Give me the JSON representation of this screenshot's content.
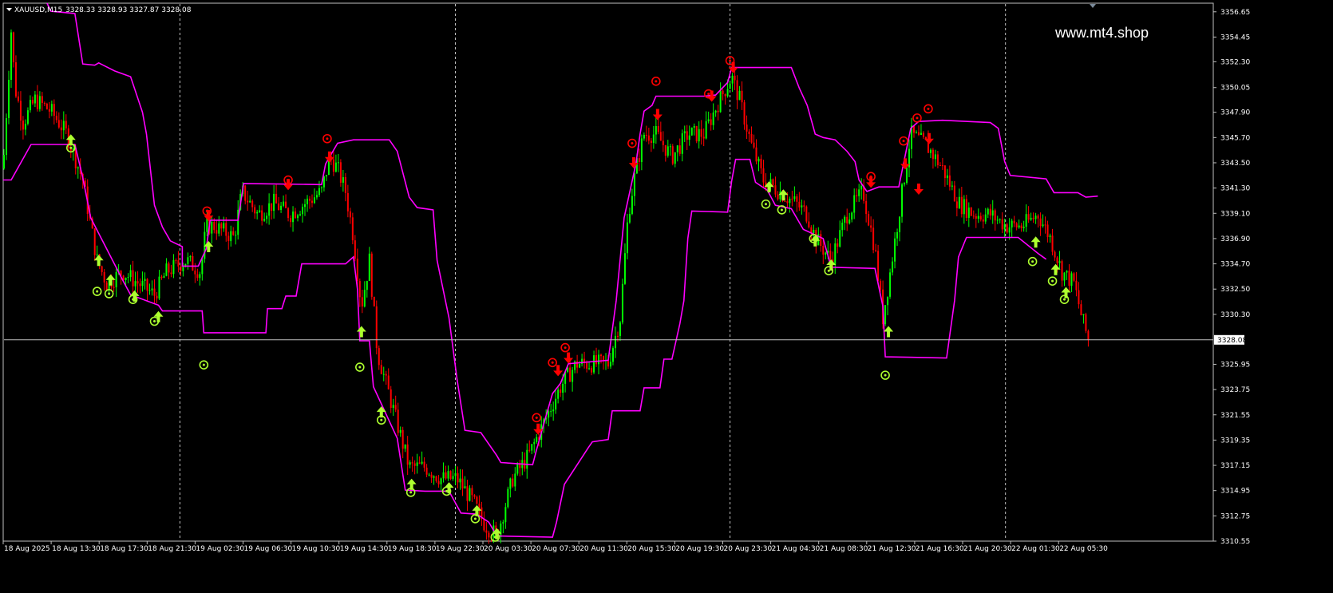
{
  "header": {
    "symbol": "XAUUSD,M15",
    "ohlc": "3328.33 3328.93 3327.87 3328.08"
  },
  "watermark": "www.mt4.shop",
  "colors": {
    "background": "#000000",
    "frame": "#c0c0c0",
    "bull_candle": "#00ff00",
    "bear_candle": "#ff0000",
    "envelope": "#ff00ff",
    "up_signal": "#adff2f",
    "down_signal": "#ff0000",
    "price_line": "#c0c0c0"
  },
  "chart_data": {
    "type": "line",
    "title": "XAUUSD,M15",
    "ylim": [
      3310.55,
      3357.4
    ],
    "y_ticks": [
      "3356.65",
      "3354.45",
      "3352.30",
      "3350.05",
      "3347.90",
      "3345.70",
      "3343.50",
      "3341.30",
      "3339.10",
      "3336.90",
      "3334.70",
      "3332.50",
      "3330.30",
      "3325.95",
      "3323.75",
      "3321.55",
      "3319.35",
      "3317.15",
      "3314.95",
      "3312.75",
      "3310.55"
    ],
    "current_price": "3328.08",
    "x_labels": [
      "18 Aug 2025",
      "18 Aug 13:30",
      "18 Aug 17:30",
      "18 Aug 21:30",
      "19 Aug 02:30",
      "19 Aug 06:30",
      "19 Aug 10:30",
      "19 Aug 14:30",
      "19 Aug 18:30",
      "19 Aug 22:30",
      "20 Aug 03:30",
      "20 Aug 07:30",
      "20 Aug 11:30",
      "20 Aug 15:30",
      "20 Aug 19:30",
      "20 Aug 23:30",
      "21 Aug 04:30",
      "21 Aug 08:30",
      "21 Aug 12:30",
      "21 Aug 16:30",
      "21 Aug 20:30",
      "22 Aug 01:30",
      "22 Aug 05:30"
    ],
    "x_domain": [
      0,
      1520
    ],
    "day_separators": [
      222,
      568,
      913,
      1259
    ],
    "price_path": [
      [
        0,
        3343
      ],
      [
        10,
        3355
      ],
      [
        15,
        3350
      ],
      [
        25,
        3347
      ],
      [
        40,
        3349
      ],
      [
        60,
        3348
      ],
      [
        80,
        3346
      ],
      [
        100,
        3342
      ],
      [
        110,
        3338
      ],
      [
        118,
        3335
      ],
      [
        130,
        3333
      ],
      [
        150,
        3334
      ],
      [
        170,
        3333
      ],
      [
        190,
        3332
      ],
      [
        205,
        3334
      ],
      [
        230,
        3335
      ],
      [
        248,
        3334
      ],
      [
        255,
        3338
      ],
      [
        265,
        3338
      ],
      [
        290,
        3337
      ],
      [
        300,
        3341
      ],
      [
        320,
        3339
      ],
      [
        340,
        3340
      ],
      [
        360,
        3339
      ],
      [
        380,
        3340
      ],
      [
        400,
        3341
      ],
      [
        410,
        3344
      ],
      [
        420,
        3343
      ],
      [
        430,
        3341
      ],
      [
        440,
        3337
      ],
      [
        450,
        3331
      ],
      [
        460,
        3335
      ],
      [
        470,
        3327
      ],
      [
        490,
        3322
      ],
      [
        510,
        3317
      ],
      [
        530,
        3317
      ],
      [
        550,
        3316
      ],
      [
        570,
        3316
      ],
      [
        590,
        3314
      ],
      [
        605,
        3312
      ],
      [
        620,
        3311
      ],
      [
        640,
        3316
      ],
      [
        660,
        3318
      ],
      [
        680,
        3321
      ],
      [
        700,
        3324
      ],
      [
        720,
        3326
      ],
      [
        740,
        3326
      ],
      [
        760,
        3326
      ],
      [
        775,
        3330
      ],
      [
        785,
        3339
      ],
      [
        795,
        3343
      ],
      [
        805,
        3346
      ],
      [
        820,
        3346
      ],
      [
        840,
        3344
      ],
      [
        860,
        3346
      ],
      [
        880,
        3346
      ],
      [
        900,
        3349
      ],
      [
        915,
        3351
      ],
      [
        925,
        3349
      ],
      [
        940,
        3345
      ],
      [
        955,
        3342
      ],
      [
        975,
        3341
      ],
      [
        995,
        3340
      ],
      [
        1010,
        3339
      ],
      [
        1020,
        3337
      ],
      [
        1040,
        3335
      ],
      [
        1060,
        3339
      ],
      [
        1080,
        3341
      ],
      [
        1095,
        3336
      ],
      [
        1105,
        3330
      ],
      [
        1112,
        3333
      ],
      [
        1125,
        3339
      ],
      [
        1140,
        3346
      ],
      [
        1160,
        3345
      ],
      [
        1180,
        3343
      ],
      [
        1200,
        3340
      ],
      [
        1220,
        3339
      ],
      [
        1240,
        3339
      ],
      [
        1260,
        3338
      ],
      [
        1280,
        3338
      ],
      [
        1300,
        3339
      ],
      [
        1315,
        3337
      ],
      [
        1330,
        3334
      ],
      [
        1345,
        3333
      ],
      [
        1355,
        3330
      ],
      [
        1363,
        3328.08
      ]
    ],
    "series": [
      {
        "name": "",
        "values": [
          [
            0,
            3342
          ],
          [
            10,
            3342
          ],
          [
            35,
            3345.1
          ],
          [
            90,
            3345.1
          ],
          [
            100,
            3342.2
          ],
          [
            110,
            3338.7
          ],
          [
            150,
            3333.3
          ],
          [
            160,
            3332
          ],
          [
            195,
            3331.1
          ],
          [
            200,
            3330.6
          ],
          [
            250,
            3330.6
          ],
          [
            252,
            3328.7
          ],
          [
            330,
            3328.7
          ],
          [
            332,
            3330.8
          ],
          [
            350,
            3330.8
          ],
          [
            355,
            3331.9
          ],
          [
            368,
            3331.9
          ],
          [
            375,
            3334.7
          ],
          [
            430,
            3334.7
          ],
          [
            440,
            3335.3
          ],
          [
            445,
            3332.5
          ],
          [
            448,
            3328
          ],
          [
            460,
            3328
          ],
          [
            465,
            3324
          ],
          [
            495,
            3319.5
          ],
          [
            505,
            3315
          ],
          [
            530,
            3314.9
          ],
          [
            560,
            3314.9
          ],
          [
            575,
            3313
          ],
          [
            595,
            3312.9
          ],
          [
            610,
            3312.2
          ],
          [
            620,
            3311
          ],
          [
            690,
            3310.9
          ],
          [
            695,
            3312.2
          ],
          [
            705,
            3315.5
          ],
          [
            735,
            3318.7
          ],
          [
            740,
            3319.2
          ],
          [
            760,
            3319.4
          ],
          [
            765,
            3321.9
          ],
          [
            800,
            3321.9
          ],
          [
            805,
            3323.9
          ],
          [
            825,
            3323.9
          ],
          [
            830,
            3326.4
          ],
          [
            840,
            3326.4
          ],
          [
            850,
            3329.5
          ],
          [
            855,
            3331.5
          ],
          [
            860,
            3336.9
          ],
          [
            865,
            3339.3
          ],
          [
            910,
            3339.2
          ],
          [
            915,
            3341.9
          ],
          [
            920,
            3343.8
          ],
          [
            938,
            3343.8
          ],
          [
            945,
            3341.8
          ],
          [
            960,
            3341.1
          ],
          [
            970,
            3339.8
          ],
          [
            990,
            3339.5
          ],
          [
            1005,
            3337.7
          ],
          [
            1030,
            3336.9
          ],
          [
            1040,
            3334.4
          ],
          [
            1095,
            3334.3
          ],
          [
            1105,
            3331
          ],
          [
            1108,
            3326.6
          ],
          [
            1185,
            3326.5
          ],
          [
            1195,
            3331.5
          ],
          [
            1200,
            3335.3
          ],
          [
            1210,
            3337
          ],
          [
            1275,
            3337
          ],
          [
            1300,
            3335.6
          ],
          [
            1310,
            3335.1
          ]
        ]
      },
      {
        "name": "",
        "values": [
          [
            55,
            3357.4
          ],
          [
            60,
            3356.7
          ],
          [
            90,
            3356.5
          ],
          [
            100,
            3352.1
          ],
          [
            115,
            3352
          ],
          [
            120,
            3352.2
          ],
          [
            140,
            3351.5
          ],
          [
            160,
            3351
          ],
          [
            175,
            3347.9
          ],
          [
            180,
            3346
          ],
          [
            190,
            3339.8
          ],
          [
            200,
            3337.9
          ],
          [
            210,
            3336.7
          ],
          [
            225,
            3336.2
          ],
          [
            225,
            3334.5
          ],
          [
            245,
            3334.5
          ],
          [
            255,
            3336
          ],
          [
            260,
            3338.5
          ],
          [
            295,
            3338.5
          ],
          [
            302,
            3341.7
          ],
          [
            400,
            3341.6
          ],
          [
            405,
            3343.4
          ],
          [
            420,
            3345.2
          ],
          [
            440,
            3345.5
          ],
          [
            485,
            3345.5
          ],
          [
            495,
            3344.5
          ],
          [
            510,
            3340.5
          ],
          [
            520,
            3339.6
          ],
          [
            540,
            3339.4
          ],
          [
            545,
            3335
          ],
          [
            560,
            3330
          ],
          [
            570,
            3324.7
          ],
          [
            580,
            3320.2
          ],
          [
            600,
            3320
          ],
          [
            620,
            3318
          ],
          [
            625,
            3317.4
          ],
          [
            665,
            3317.2
          ],
          [
            670,
            3318.5
          ],
          [
            680,
            3321
          ],
          [
            690,
            3323.4
          ],
          [
            700,
            3324.3
          ],
          [
            710,
            3326
          ],
          [
            760,
            3326.3
          ],
          [
            770,
            3331.5
          ],
          [
            780,
            3338.7
          ],
          [
            795,
            3343.5
          ],
          [
            800,
            3346
          ],
          [
            805,
            3348
          ],
          [
            815,
            3348.5
          ],
          [
            820,
            3349.3
          ],
          [
            880,
            3349.3
          ],
          [
            895,
            3349.4
          ],
          [
            910,
            3350.5
          ],
          [
            915,
            3351.8
          ],
          [
            990,
            3351.8
          ],
          [
            1000,
            3350
          ],
          [
            1010,
            3348.5
          ],
          [
            1020,
            3346
          ],
          [
            1030,
            3345.7
          ],
          [
            1045,
            3345.5
          ],
          [
            1060,
            3344.5
          ],
          [
            1070,
            3343.6
          ],
          [
            1075,
            3342
          ],
          [
            1085,
            3341
          ],
          [
            1100,
            3341.4
          ],
          [
            1125,
            3341.4
          ],
          [
            1140,
            3346.5
          ],
          [
            1150,
            3347.1
          ],
          [
            1180,
            3347.2
          ],
          [
            1240,
            3347
          ],
          [
            1250,
            3346.5
          ],
          [
            1258,
            3343.6
          ],
          [
            1265,
            3342.4
          ],
          [
            1310,
            3342.1
          ],
          [
            1320,
            3340.9
          ],
          [
            1350,
            3340.9
          ],
          [
            1360,
            3340.5
          ],
          [
            1375,
            3340.6
          ]
        ]
      }
    ],
    "up_arrows": [
      [
        85,
        3345.5
      ],
      [
        120,
        3335
      ],
      [
        135,
        3333.3
      ],
      [
        165,
        3331.9
      ],
      [
        195,
        3330.1
      ],
      [
        258,
        3336.2
      ],
      [
        450,
        3328.8
      ],
      [
        475,
        3321.8
      ],
      [
        513,
        3315.5
      ],
      [
        560,
        3315.2
      ],
      [
        595,
        3313.2
      ],
      [
        620,
        3311.2
      ],
      [
        962,
        3341.4
      ],
      [
        980,
        3340.7
      ],
      [
        1020,
        3336.7
      ],
      [
        1040,
        3334.6
      ],
      [
        1112,
        3328.8
      ],
      [
        1297,
        3336.6
      ],
      [
        1322,
        3334.2
      ],
      [
        1335,
        3332.2
      ]
    ],
    "up_circles": [
      [
        85,
        3344.8
      ],
      [
        118,
        3332.3
      ],
      [
        133,
        3332.1
      ],
      [
        163,
        3331.6
      ],
      [
        190,
        3329.7
      ],
      [
        252,
        3325.9
      ],
      [
        448,
        3325.7
      ],
      [
        475,
        3321.1
      ],
      [
        512,
        3314.8
      ],
      [
        557,
        3314.9
      ],
      [
        593,
        3312.5
      ],
      [
        618,
        3310.9
      ],
      [
        958,
        3339.9
      ],
      [
        978,
        3339.4
      ],
      [
        1018,
        3336.9
      ],
      [
        1037,
        3334.1
      ],
      [
        1108,
        3325
      ],
      [
        1293,
        3334.9
      ],
      [
        1318,
        3333.2
      ],
      [
        1333,
        3331.6
      ]
    ],
    "down_arrows": [
      [
        258,
        3338.9
      ],
      [
        358,
        3341.6
      ],
      [
        410,
        3344
      ],
      [
        672,
        3320.3
      ],
      [
        697,
        3325.4
      ],
      [
        710,
        3326.5
      ],
      [
        792,
        3343.5
      ],
      [
        822,
        3347.7
      ],
      [
        890,
        3349.3
      ],
      [
        917,
        3351.8
      ],
      [
        1090,
        3341.8
      ],
      [
        1133,
        3343.4
      ],
      [
        1150,
        3341.2
      ],
      [
        1163,
        3345.6
      ]
    ],
    "down_circles": [
      [
        256,
        3339.3
      ],
      [
        358,
        3342
      ],
      [
        407,
        3345.6
      ],
      [
        670,
        3321.3
      ],
      [
        690,
        3326.1
      ],
      [
        706,
        3327.4
      ],
      [
        790,
        3345.2
      ],
      [
        820,
        3350.6
      ],
      [
        886,
        3349.5
      ],
      [
        913,
        3352.4
      ],
      [
        1090,
        3342.3
      ],
      [
        1131,
        3345.4
      ],
      [
        1148,
        3347.4
      ],
      [
        1162,
        3348.2
      ]
    ]
  }
}
